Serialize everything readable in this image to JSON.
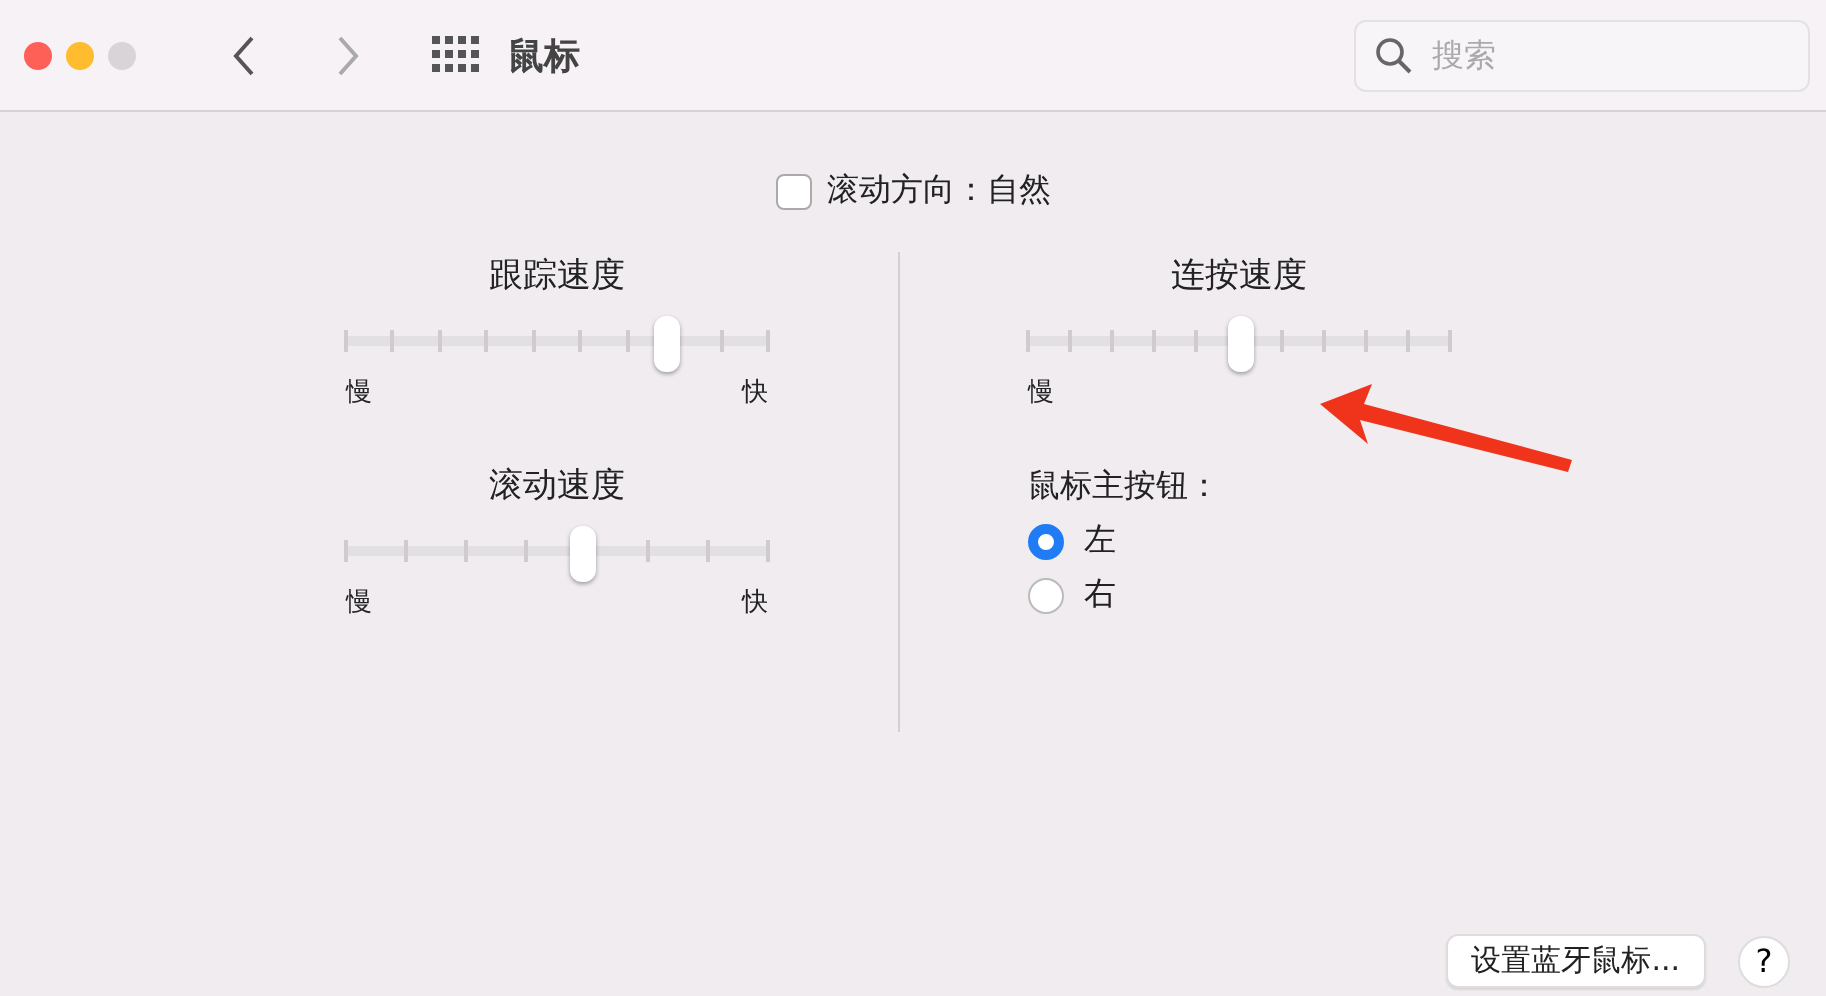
{
  "window": {
    "title": "鼠标",
    "search": {
      "placeholder": "搜索"
    }
  },
  "scroll_direction": {
    "label": "滚动方向：自然",
    "checked": false
  },
  "left_sliders": [
    {
      "title": "跟踪速度",
      "level": 0.76,
      "min_label": "慢",
      "max_label": "快"
    },
    {
      "title": "滚动速度",
      "level": 0.56,
      "min_label": "慢",
      "max_label": "快"
    }
  ],
  "double_click": {
    "title": "连按速度",
    "level": 0.5,
    "min_label": "慢"
  },
  "primary_button": {
    "label": "鼠标主按钮：",
    "options": [
      {
        "label": "左",
        "selected": true
      },
      {
        "label": "右",
        "selected": false
      }
    ]
  },
  "buttons": {
    "bluetooth": "设置蓝牙鼠标...",
    "help": "?"
  }
}
